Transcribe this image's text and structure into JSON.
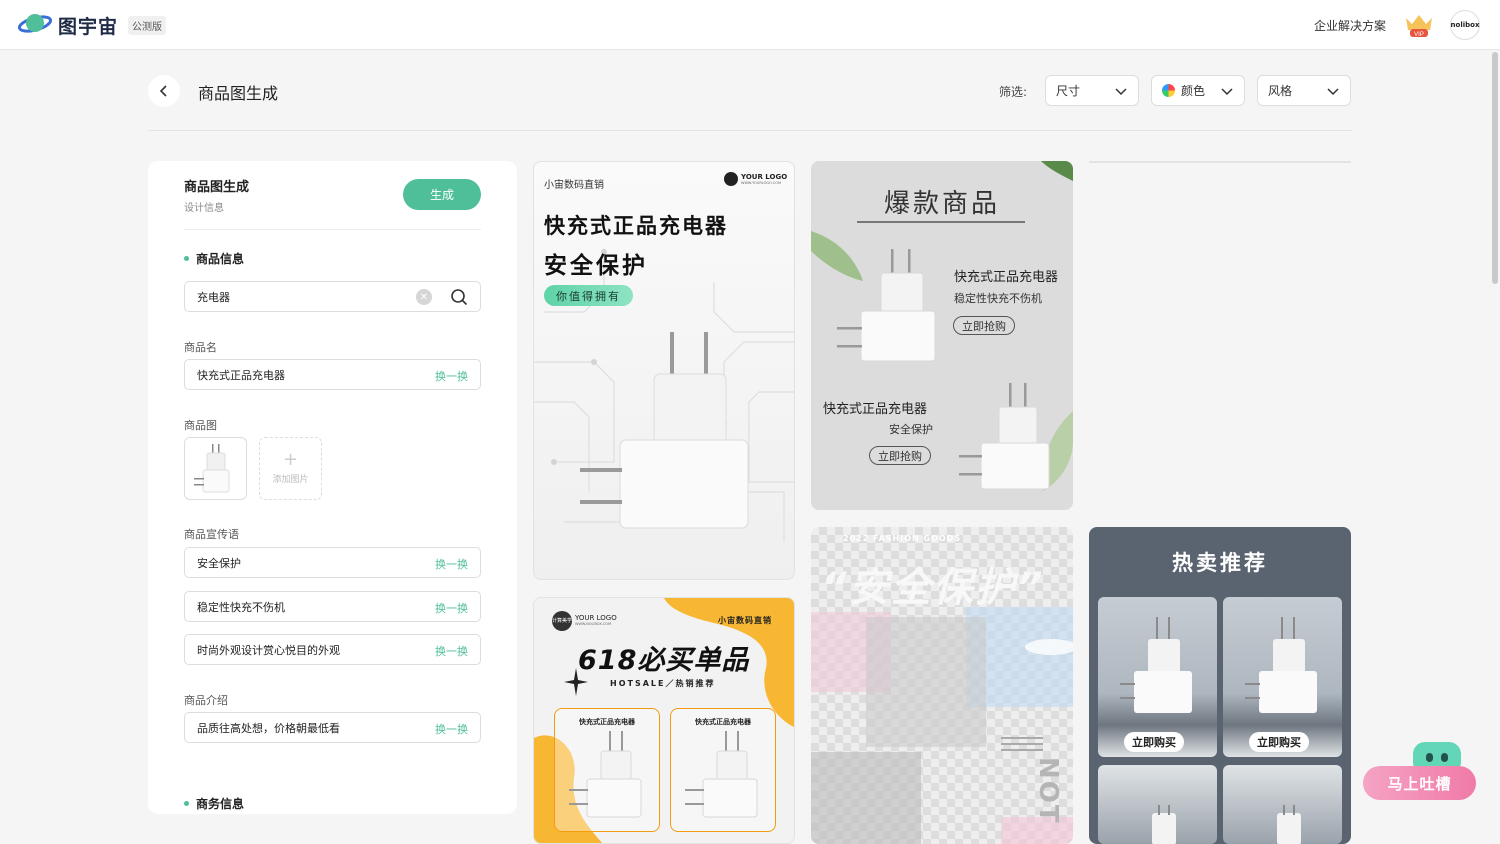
{
  "header": {
    "brand": "图宇宙",
    "beta_tag": "公测版",
    "enterprise_link": "企业解决方案",
    "vip_badge": "VIP",
    "avatar_text": "nolibox"
  },
  "page": {
    "title": "商品图生成",
    "filter_label": "筛选:",
    "filters": {
      "size": "尺寸",
      "color": "颜色",
      "style": "风格"
    }
  },
  "panel": {
    "title": "商品图生成",
    "subtitle": "设计信息",
    "generate_label": "生成",
    "product_info_heading": "商品信息",
    "search_value": "充电器",
    "name_label": "商品名",
    "name_value": "快充式正品充电器",
    "swap_label": "换一换",
    "image_label": "商品图",
    "add_image_label": "添加图片",
    "slogan_label": "商品宣传语",
    "slogans": [
      "安全保护",
      "稳定性快充不伤机",
      "时尚外观设计赏心悦目的外观"
    ],
    "intro_label": "商品介绍",
    "intro_value": "品质往高处想，价格朝最低看",
    "business_heading": "商务信息"
  },
  "cards": {
    "c1": {
      "shop": "小宙数码直销",
      "logo": "YOUR LOGO",
      "logo_sub": "WWW.YOURLOGO.COM",
      "headline1": "快充式正品充电器",
      "headline2": "安全保护",
      "badge": "你值得拥有"
    },
    "c2": {
      "title": "爆款商品",
      "name1": "快充式正品充电器",
      "desc1": "稳定性快充不伤机",
      "btn1": "立即抢购",
      "name2": "快充式正品充电器",
      "desc2": "安全保护",
      "btn2": "立即抢购"
    },
    "c3": {
      "logo": "YOUR LOGO",
      "logo_sub": "WWW.NOLIBOX.COM",
      "logo_mark": "计算美学",
      "shop": "小宙数码直销",
      "headline": "618必买单品",
      "sub": "HOTSALE／热销推荐",
      "item1": "快充式正品充电器",
      "item2": "快充式正品充电器"
    },
    "c4": {
      "top_text": "2022 FASHION GOODS",
      "headline": "“安全保护”",
      "side_text": "NOT"
    },
    "c5": {
      "title": "热卖推荐",
      "btn1": "立即购买",
      "btn2": "立即购买"
    }
  },
  "feedback": {
    "label": "马上吐槽"
  },
  "colors": {
    "accent": "#4fbf9a",
    "orange": "#f7b733",
    "feedback_pink": "#f07aa8"
  }
}
